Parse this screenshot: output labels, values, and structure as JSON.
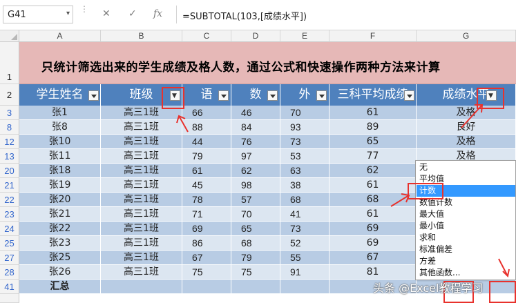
{
  "namebox": {
    "value": "G41"
  },
  "formula": {
    "cancel_icon": "✕",
    "enter_icon": "✓",
    "fx_label": "fx",
    "value": "=SUBTOTAL(103,[成绩水平])"
  },
  "columns": [
    "A",
    "B",
    "C",
    "D",
    "E",
    "F",
    "G"
  ],
  "title_row": {
    "row_number": "1",
    "text": "只统计筛选出来的学生成绩及格人数，通过公式和快速操作两种方法来计算"
  },
  "header_row": {
    "row_number": "2",
    "labels": [
      "学生姓名",
      "班级",
      "语",
      "数",
      "外",
      "三科平均成绩",
      "成绩水平"
    ]
  },
  "rows": [
    {
      "num": "3",
      "name": "张1",
      "cls": "高三1班",
      "c": "66",
      "d": "46",
      "e": "70",
      "f": "61",
      "g": "及格"
    },
    {
      "num": "8",
      "name": "张8",
      "cls": "高三1班",
      "c": "88",
      "d": "84",
      "e": "93",
      "f": "89",
      "g": "良好"
    },
    {
      "num": "12",
      "name": "张10",
      "cls": "高三1班",
      "c": "44",
      "d": "76",
      "e": "73",
      "f": "65",
      "g": "及格"
    },
    {
      "num": "13",
      "name": "张11",
      "cls": "高三1班",
      "c": "79",
      "d": "97",
      "e": "53",
      "f": "77",
      "g": "及格"
    },
    {
      "num": "20",
      "name": "张18",
      "cls": "高三1班",
      "c": "61",
      "d": "62",
      "e": "63",
      "f": "62",
      "g": ""
    },
    {
      "num": "21",
      "name": "张19",
      "cls": "高三1班",
      "c": "45",
      "d": "98",
      "e": "38",
      "f": "61",
      "g": ""
    },
    {
      "num": "22",
      "name": "张20",
      "cls": "高三1班",
      "c": "78",
      "d": "57",
      "e": "68",
      "f": "68",
      "g": ""
    },
    {
      "num": "23",
      "name": "张21",
      "cls": "高三1班",
      "c": "71",
      "d": "70",
      "e": "41",
      "f": "61",
      "g": ""
    },
    {
      "num": "24",
      "name": "张22",
      "cls": "高三1班",
      "c": "69",
      "d": "65",
      "e": "73",
      "f": "69",
      "g": ""
    },
    {
      "num": "25",
      "name": "张23",
      "cls": "高三1班",
      "c": "86",
      "d": "68",
      "e": "52",
      "f": "69",
      "g": ""
    },
    {
      "num": "27",
      "name": "张25",
      "cls": "高三1班",
      "c": "67",
      "d": "79",
      "e": "55",
      "f": "67",
      "g": ""
    },
    {
      "num": "28",
      "name": "张26",
      "cls": "高三1班",
      "c": "75",
      "d": "75",
      "e": "91",
      "f": "81",
      "g": ""
    }
  ],
  "total_row": {
    "num": "41",
    "label": "汇总"
  },
  "dropdown": {
    "items": [
      "无",
      "平均值",
      "计数",
      "数值计数",
      "最大值",
      "最小值",
      "求和",
      "标准偏差",
      "方差",
      "其他函数..."
    ],
    "selected": "计数"
  },
  "watermark": "头条 @Excel教程学习",
  "colors": {
    "header_blue": "#4f81bd",
    "band_dark": "#b8cce4",
    "band_light": "#dce6f1",
    "title_bg": "#e6b8b7",
    "annotation_red": "#e8322d",
    "selected_blue": "#3399ff"
  }
}
